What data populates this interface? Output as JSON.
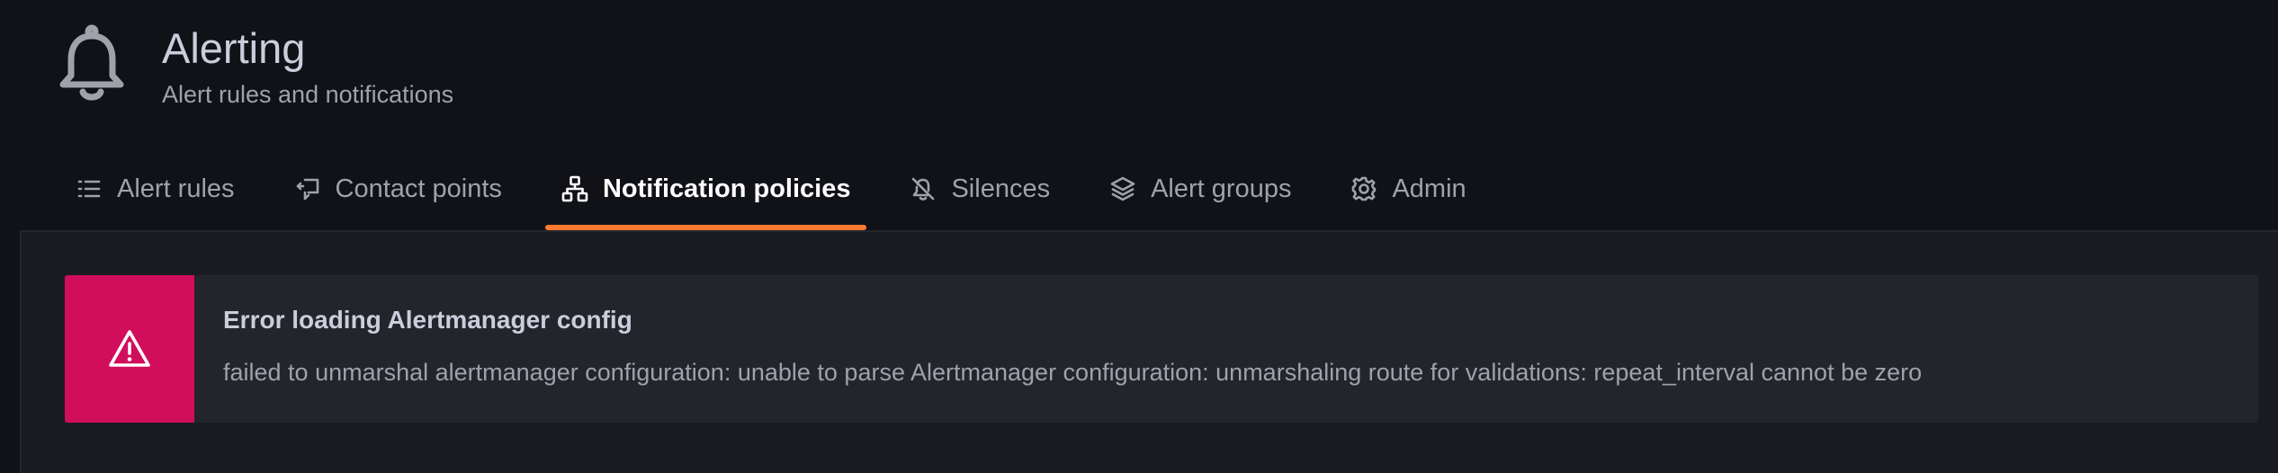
{
  "header": {
    "icon": "bell-icon",
    "title": "Alerting",
    "subtitle": "Alert rules and notifications"
  },
  "tabs": [
    {
      "label": "Alert rules",
      "icon": "list-icon",
      "active": false
    },
    {
      "label": "Contact points",
      "icon": "comment-icon",
      "active": false
    },
    {
      "label": "Notification policies",
      "icon": "sitemap-icon",
      "active": true
    },
    {
      "label": "Silences",
      "icon": "bell-slash-icon",
      "active": false
    },
    {
      "label": "Alert groups",
      "icon": "layer-group-icon",
      "active": false
    },
    {
      "label": "Admin",
      "icon": "cog-icon",
      "active": false
    }
  ],
  "alert": {
    "icon": "exclamation-triangle-icon",
    "title": "Error loading Alertmanager config",
    "message": "failed to unmarshal alertmanager configuration: unable to parse Alertmanager configuration: unmarshaling route for validations: repeat_interval cannot be zero"
  },
  "colors": {
    "background": "#111217",
    "panel": "#181b1f",
    "alert_bg": "#22252b",
    "error": "#d10e5c",
    "active_tab_underline": "#ff7a2e"
  }
}
